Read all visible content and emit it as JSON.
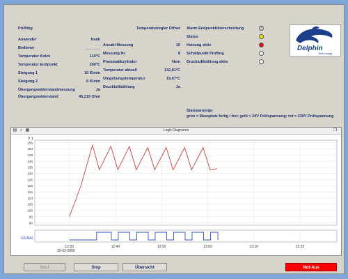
{
  "left_panel": {
    "rows": [
      {
        "label": "Prüfling",
        "value": ""
      },
      {
        "label": "Anwender",
        "value": "frank"
      },
      {
        "label": "Bediener",
        "value": "_______"
      },
      {
        "label": "Temperatur Knick",
        "value": "110°C"
      },
      {
        "label": "Temperatur Endpunkt",
        "value": "260°C"
      },
      {
        "label": "Steigung 1",
        "value": "10 K/min"
      },
      {
        "label": "Steigung 2",
        "value": "6 K/min"
      },
      {
        "label": "Übergangswiderstandmessung",
        "value": "Ja"
      },
      {
        "label": "Übergangswiderstand",
        "value": "45,219 Ohm"
      }
    ]
  },
  "middle_panel": {
    "title": "Temperaturregler Offner",
    "rows": [
      {
        "label": "Anzahl Messung",
        "value": "10"
      },
      {
        "label": "Messung Nr.",
        "value": "8"
      },
      {
        "label": "Pneumatikzylinder",
        "value": "Nein"
      },
      {
        "label": "Temperatur aktuell",
        "value": "132,81°C"
      },
      {
        "label": "Umgebungstemperatur",
        "value": "19,07°C"
      },
      {
        "label": "Druckluftkühlung",
        "value": "Ja"
      }
    ]
  },
  "status_panel": {
    "items": [
      {
        "label": "Alarm Endpunktüberschreitung",
        "state": "off-x",
        "color": "#d9d9d9"
      },
      {
        "label": "Status",
        "state": "yellow",
        "color": "#f3e600"
      },
      {
        "label": "Heizung aktiv",
        "state": "red",
        "color": "#e01010"
      },
      {
        "label": "Schaltpunkt Prüfling",
        "state": "off",
        "color": "#ffffff"
      },
      {
        "label": "Druckluftkühlung aktiv",
        "state": "off",
        "color": "#ffffff"
      }
    ],
    "legend_title": "Statusanzeige:",
    "legend_text": "grün = Messplatz fertig / frei; gelb = 24V Prüfspannung; rot = 230V Prüfspannung"
  },
  "logo": {
    "name": "Delphin",
    "subtitle": "Technology",
    "icon": "dolphin-icon"
  },
  "chart": {
    "window_title": "Logik Diagramm",
    "unit_label": "V 1",
    "signal_label": "SIGNAL",
    "date_label": "30-03-2009"
  },
  "chart_data": {
    "type": "line",
    "title": "Logik Diagramm",
    "ylabel": "V 1",
    "ylim": [
      88,
      157
    ],
    "y_ticks": [
      90,
      95,
      100,
      105,
      110,
      115,
      120,
      125,
      130,
      135,
      140,
      145,
      150,
      155
    ],
    "x_tick_labels": [
      "12:30",
      "12:40",
      "12:50",
      "13:00",
      "13:10",
      "13:20"
    ],
    "series": [
      {
        "name": "V 1",
        "color": "#d04040",
        "x_minutes": [
          0,
          2.5,
          5.0,
          6.5,
          9.0,
          10.5,
          13.0,
          14.5,
          17.0,
          18.5,
          21.0,
          22.5,
          25.0,
          26.5,
          29.0,
          30.5,
          32.0
        ],
        "values": [
          95,
          120,
          153,
          133,
          152,
          133,
          152,
          133,
          151,
          133,
          151,
          133,
          151,
          133,
          151,
          133,
          134
        ]
      }
    ],
    "signal_series": {
      "name": "SIGNAL",
      "color": "#3050c8",
      "x_minutes": [
        0,
        5.9,
        9.1,
        10.6,
        13.1,
        14.6,
        17.1,
        18.6,
        21.1,
        22.6,
        25.1,
        26.6,
        29.1,
        30.6,
        32.2
      ],
      "values": [
        0,
        1,
        0,
        1,
        0,
        1,
        0,
        1,
        0,
        1,
        0,
        1,
        0,
        1,
        0
      ]
    }
  },
  "buttons": {
    "start": "Start",
    "stop": "Stop",
    "overview": "Übersicht",
    "emergency": "Not-Aus"
  }
}
